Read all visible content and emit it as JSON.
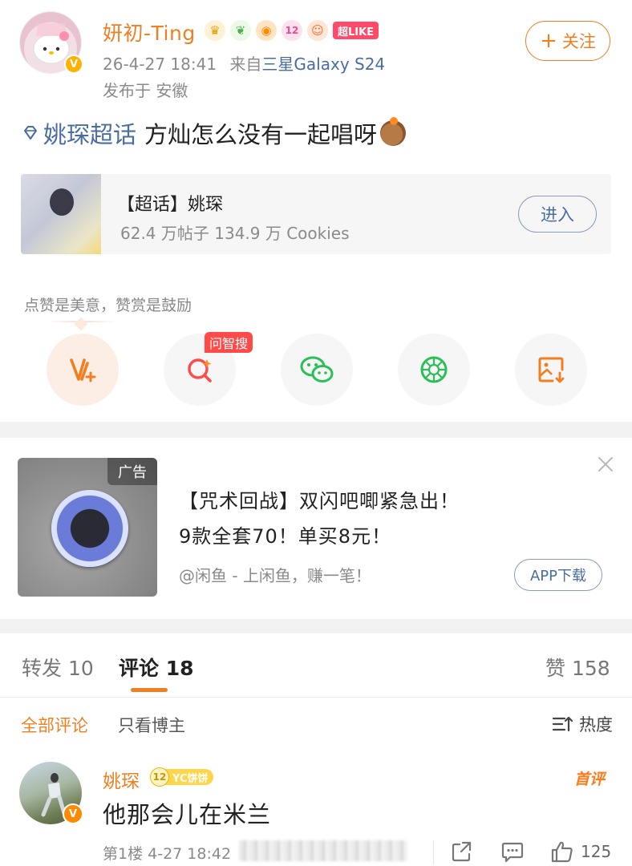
{
  "post": {
    "author": "妍初-Ting",
    "verified_badge": "V",
    "badge_icons": [
      "crown-icon",
      "sprout-icon",
      "fish-icon",
      "level-12-icon",
      "monkey-face-icon"
    ],
    "level_badge_text": "12",
    "like_badge": "超LIKE",
    "time": "26-4-27 18:41",
    "source_prefix": "来自",
    "source_device": "三星Galaxy S24",
    "location": "发布于 安徽",
    "follow_label": "关注",
    "follow_plus": "+",
    "topic_link": "姚琛超话",
    "text": "方灿怎么没有一起唱呀"
  },
  "topic_card": {
    "title": "【超话】姚琛",
    "stats": "62.4 万帖子 134.9 万 Cookies",
    "enter_label": "进入"
  },
  "reward": {
    "hint": "点赞是美意，赞赏是鼓励",
    "ask_tag": "问智搜"
  },
  "ad": {
    "tag": "广告",
    "line1": "【咒术回战】双闪吧唧紧急出！",
    "line2": "9款全套70！单买8元！",
    "source": "@闲鱼 - 上闲鱼，赚一笔！",
    "app_button": "APP下载"
  },
  "tabs": {
    "repost": "转发 10",
    "comments": "评论 18",
    "likes": "赞 158"
  },
  "filters": {
    "all": "全部评论",
    "author_only": "只看博主",
    "sort": "热度"
  },
  "comment": {
    "author": "姚琛",
    "verified_badge": "V",
    "fan_level": "12",
    "fan_name": "YC饼饼",
    "first_tag": "首评",
    "text": "他那会儿在米兰",
    "meta": "第1楼 4-27 18:42",
    "like_count": "125"
  },
  "colors": {
    "accent_orange": "#f07f21",
    "link_blue": "#4a6da0",
    "ask_red": "#ff4a4a",
    "wechat_green": "#2bbf5a"
  }
}
